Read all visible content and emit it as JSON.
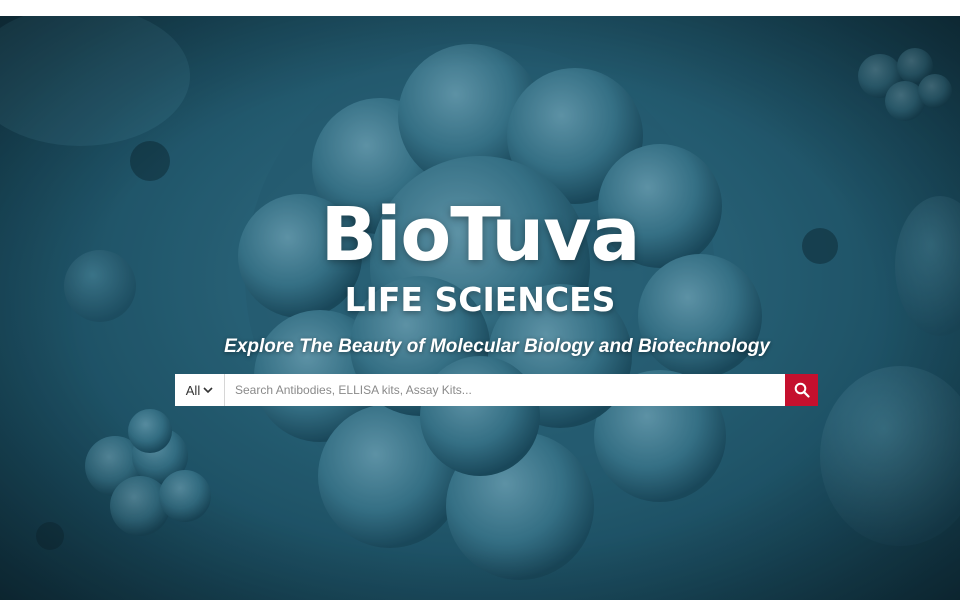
{
  "hero": {
    "brand_title": "BioTuva",
    "brand_subtitle": "LIFE SCIENCES",
    "tagline": "Explore The Beauty of Molecular Biology and Biotechnology"
  },
  "search": {
    "category": "All",
    "placeholder": "Search Antibodies, ELLISA kits, Assay Kits...",
    "value": ""
  },
  "icons": {
    "category_dropdown": "chevron-down-icon",
    "search_button": "search-icon"
  },
  "colors": {
    "search_button": "#c5102e",
    "hero_background": "#2d6a80",
    "text": "#ffffff"
  }
}
